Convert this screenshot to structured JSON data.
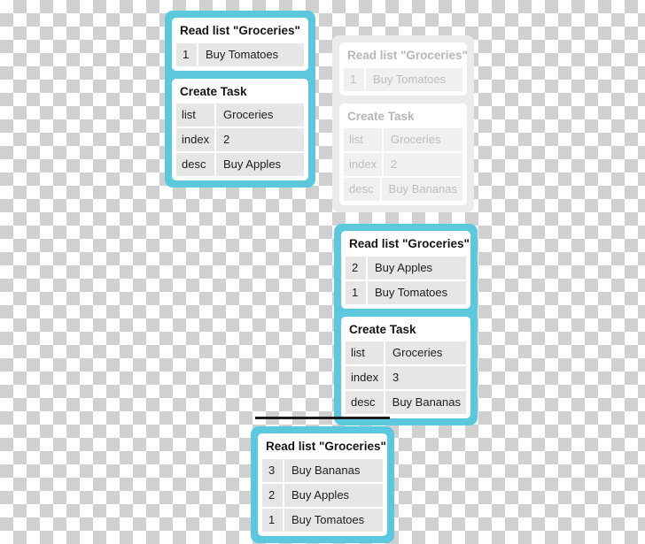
{
  "diagram": {
    "connector": {
      "name": "arrow-line"
    },
    "groups": [
      {
        "id": "group-initial",
        "style": "active",
        "cards": [
          {
            "title": "Read list \"Groceries\"",
            "row_type": "list",
            "rows": [
              {
                "key": "1",
                "value": "Buy Tomatoes"
              }
            ]
          },
          {
            "title": "Create Task",
            "row_type": "kv",
            "rows": [
              {
                "key": "list",
                "value": "Groceries"
              },
              {
                "key": "index",
                "value": "2"
              },
              {
                "key": "desc",
                "value": "Buy Apples"
              }
            ]
          }
        ]
      },
      {
        "id": "group-ghost",
        "style": "ghost",
        "cards": [
          {
            "title": "Read list \"Groceries\"",
            "row_type": "list",
            "rows": [
              {
                "key": "1",
                "value": "Buy Tomatoes"
              }
            ]
          },
          {
            "title": "Create Task",
            "row_type": "kv",
            "rows": [
              {
                "key": "list",
                "value": "Groceries"
              },
              {
                "key": "index",
                "value": "2"
              },
              {
                "key": "desc",
                "value": "Buy Bananas"
              }
            ]
          }
        ]
      },
      {
        "id": "group-after",
        "style": "active",
        "cards": [
          {
            "title": "Read list \"Groceries\"",
            "row_type": "list",
            "rows": [
              {
                "key": "2",
                "value": "Buy Apples"
              },
              {
                "key": "1",
                "value": "Buy Tomatoes"
              }
            ]
          },
          {
            "title": "Create Task",
            "row_type": "kv",
            "rows": [
              {
                "key": "list",
                "value": "Groceries"
              },
              {
                "key": "index",
                "value": "3"
              },
              {
                "key": "desc",
                "value": "Buy Bananas"
              }
            ]
          }
        ]
      },
      {
        "id": "group-final",
        "style": "active",
        "cards": [
          {
            "title": "Read list \"Groceries\"",
            "row_type": "list",
            "rows": [
              {
                "key": "3",
                "value": "Buy Bananas"
              },
              {
                "key": "2",
                "value": "Buy Apples"
              },
              {
                "key": "1",
                "value": "Buy Tomatoes"
              }
            ]
          }
        ]
      }
    ],
    "colors": {
      "highlight": "#5bc8dd",
      "ghost_highlight": "#ebebeb",
      "card_background": "#ffffff",
      "row_background": "#e6e6e6",
      "ghost_row_background": "#f0f0f0",
      "text": "#141414",
      "ghost_text": "#bdbdbd",
      "connector": "#1a1a1a"
    }
  }
}
